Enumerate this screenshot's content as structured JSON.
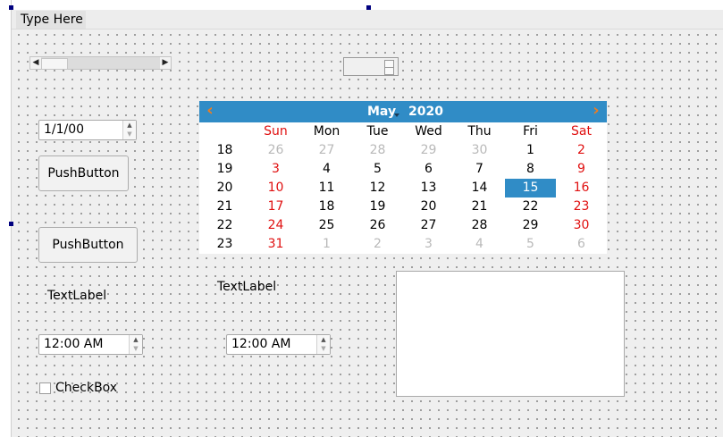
{
  "menubar": {
    "menu_label": "Type Here"
  },
  "date_edit": {
    "value": "1/1/00"
  },
  "push_buttons": [
    "PushButton",
    "PushButton"
  ],
  "text_labels": [
    "TextLabel",
    "TextLabel"
  ],
  "time_edits": [
    "12:00 AM",
    "12:00 AM"
  ],
  "checkbox": {
    "label": "CheckBox",
    "checked": false
  },
  "calendar": {
    "month": "May",
    "year": "2020",
    "prev_icon": "chevron-left-icon",
    "next_icon": "chevron-right-icon",
    "weekdays": [
      "Sun",
      "Mon",
      "Tue",
      "Wed",
      "Thu",
      "Fri",
      "Sat"
    ],
    "weeks": [
      {
        "num": "18",
        "days": [
          "26",
          "27",
          "28",
          "29",
          "30",
          "1",
          "2"
        ]
      },
      {
        "num": "19",
        "days": [
          "3",
          "4",
          "5",
          "6",
          "7",
          "8",
          "9"
        ]
      },
      {
        "num": "20",
        "days": [
          "10",
          "11",
          "12",
          "13",
          "14",
          "15",
          "16"
        ]
      },
      {
        "num": "21",
        "days": [
          "17",
          "18",
          "19",
          "20",
          "21",
          "22",
          "23"
        ]
      },
      {
        "num": "22",
        "days": [
          "24",
          "25",
          "26",
          "27",
          "28",
          "29",
          "30"
        ]
      },
      {
        "num": "23",
        "days": [
          "31",
          "1",
          "2",
          "3",
          "4",
          "5",
          "6"
        ]
      }
    ],
    "selected_day": "15",
    "colors": {
      "header_bg": "#308cc6",
      "nav_arrow": "#f07c1e",
      "weekend": "#e01010",
      "dim": "#b9b9b9"
    }
  },
  "icons": {
    "scroll_left": "arrow-left-icon",
    "scroll_right": "arrow-right-icon",
    "spin_up": "spin-up-icon",
    "spin_down": "spin-down-icon"
  }
}
